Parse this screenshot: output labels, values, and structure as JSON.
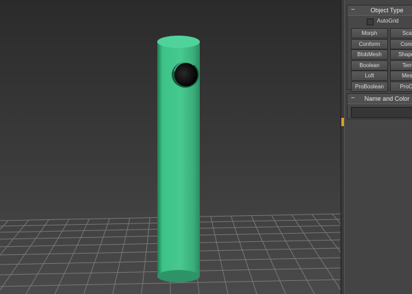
{
  "viewport": {
    "object_color": "#3fbf86",
    "grid_color": "#8a8a8a"
  },
  "object_type": {
    "title": "Object Type",
    "autogrid_label": "AutoGrid",
    "autogrid_checked": false,
    "buttons": [
      "Morph",
      "Scatt",
      "Conform",
      "Conne",
      "BlobMesh",
      "ShapeM",
      "Boolean",
      "Terra",
      "Loft",
      "Mesh",
      "ProBoolean",
      "ProCut"
    ]
  },
  "name_and_color": {
    "title": "Name and Color",
    "name_value": ""
  },
  "colors": {
    "accent": "#d9a21b",
    "panel": "#444444"
  }
}
